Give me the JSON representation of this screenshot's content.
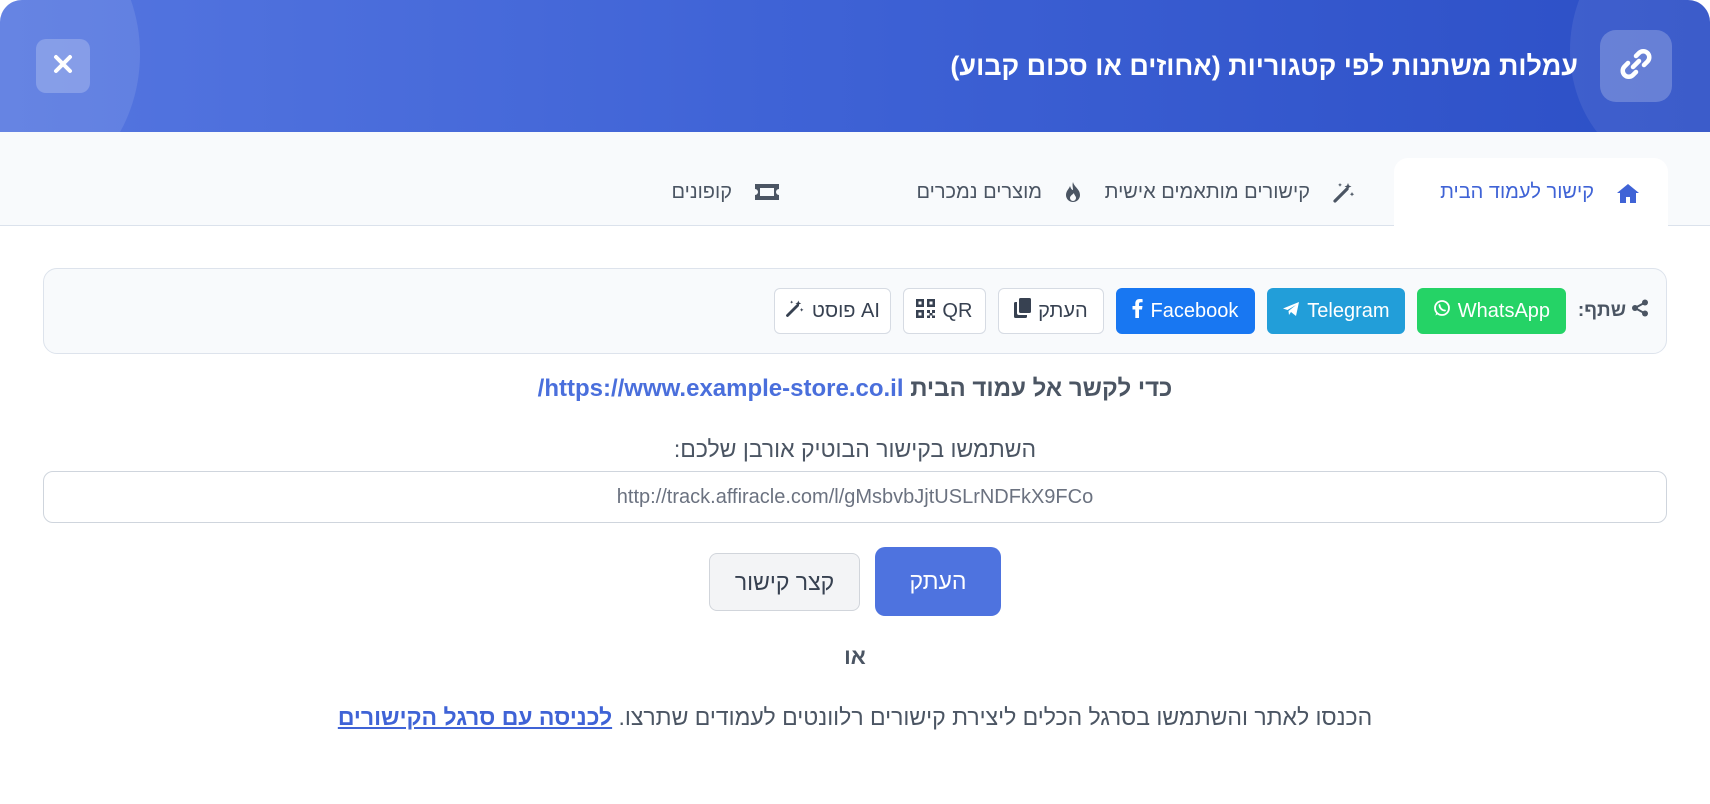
{
  "colors": {
    "brand": "#3f63d6",
    "whatsapp": "#25d366",
    "telegram": "#229ed9",
    "facebook": "#1877f2",
    "primary_button": "#4e73df"
  },
  "header": {
    "title": "עמלות משתנות לפי קטגוריות (אחוזים או סכום קבוע)",
    "icon": "link-icon",
    "close_icon": "close-icon"
  },
  "tabs": [
    {
      "label": "קישור לעמוד הבית",
      "icon": "home-icon",
      "active": true
    },
    {
      "label": "קישורים מותאמים אישית",
      "icon": "magic-wand-icon",
      "active": false
    },
    {
      "label": "מוצרים נמכרים",
      "icon": "fire-icon",
      "active": false
    },
    {
      "label": "קופונים",
      "icon": "ticket-icon",
      "active": false
    }
  ],
  "share": {
    "label": "שתף:",
    "buttons": {
      "whatsapp": "WhatsApp",
      "telegram": "Telegram",
      "facebook": "Facebook",
      "copy": "העתק",
      "qr": "QR",
      "ai_post": "פוסט AI"
    }
  },
  "homepage": {
    "text": "כדי לקשר אל עמוד הבית",
    "url": "https://www.example-store.co.il/"
  },
  "link_field": {
    "label": "השתמשו בקישור הבוטיק אורבן שלכם:",
    "value": "http://track.affiracle.com/l/gMsbvbJjtUSLrNDFkX9FCo"
  },
  "actions": {
    "copy": "העתק",
    "shorten": "קצר קישור",
    "or": "או"
  },
  "footer": {
    "text": "הכנסו לאתר והשתמשו בסרגל הכלים ליצירת קישורים רלוונטים לעמודים שתרצו.",
    "link": "לכניסה עם סרגל הקישורים"
  }
}
